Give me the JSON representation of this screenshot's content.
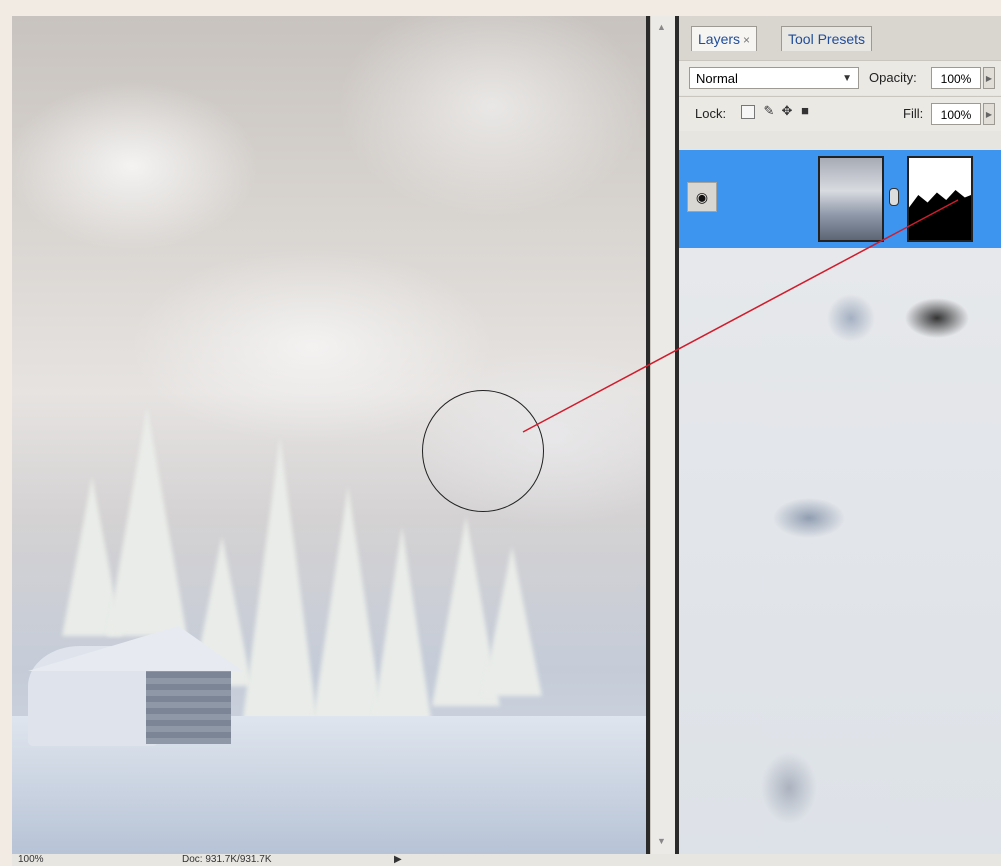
{
  "layers_panel": {
    "tabs": [
      {
        "label": "Layers",
        "close": "×"
      },
      {
        "label": "Tool Presets"
      }
    ],
    "blend_mode": "Normal",
    "opacity_label": "Opacity:",
    "opacity_value": "100%",
    "lock_label": "Lock:",
    "fill_label": "Fill:",
    "fill_value": "100%",
    "layer": {
      "visible_icon": "eye-icon",
      "thumb": "cloud-image",
      "mask": "layer-mask"
    }
  },
  "statusbar": {
    "zoom": "100%",
    "doc": "Doc: 931.7K/931.7K"
  },
  "colors": {
    "selection": "#3d95f0",
    "annotation": "#d01c2c"
  }
}
